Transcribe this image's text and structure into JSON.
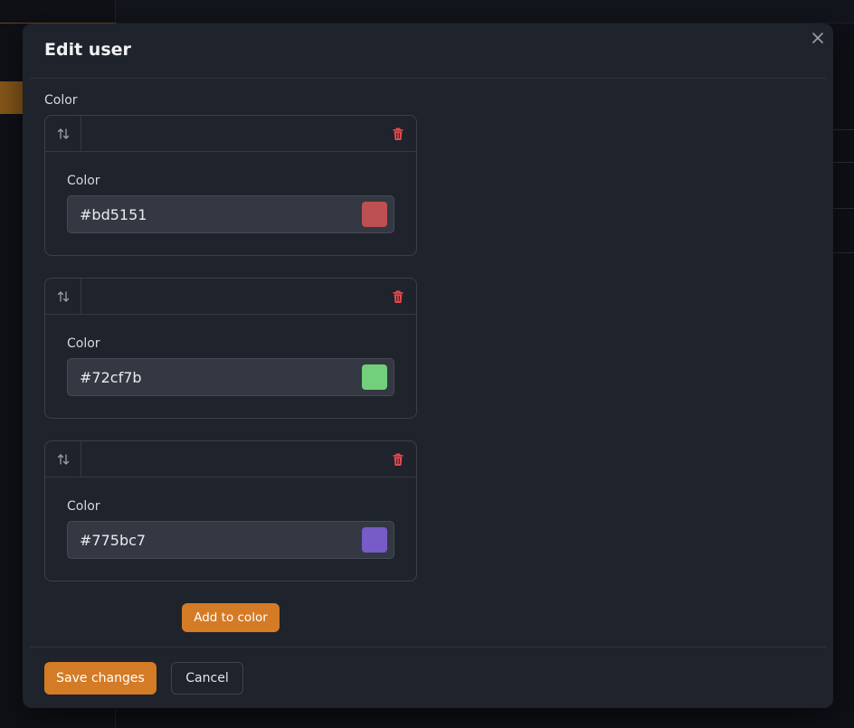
{
  "modal": {
    "title": "Edit user",
    "close_icon": "close-icon"
  },
  "field": {
    "label": "Color"
  },
  "colors": [
    {
      "label": "Color",
      "value": "#bd5151",
      "swatch": "#bd5151"
    },
    {
      "label": "Color",
      "value": "#72cf7b",
      "swatch": "#72cf7b"
    },
    {
      "label": "Color",
      "value": "#775bc7",
      "swatch": "#775bc7"
    }
  ],
  "icons": {
    "drag": "swap-vertical-icon",
    "delete": "trash-icon"
  },
  "buttons": {
    "add": "Add to color",
    "save": "Save changes",
    "cancel": "Cancel"
  },
  "theme": {
    "accent": "#d47b26",
    "danger": "#e5484d",
    "surface": "#1f232c"
  }
}
